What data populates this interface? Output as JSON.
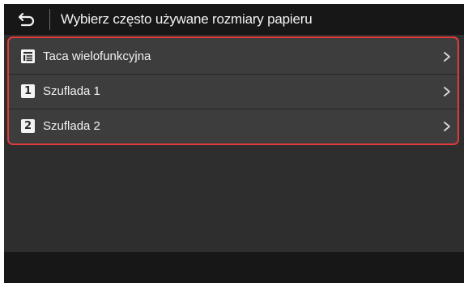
{
  "header": {
    "title": "Wybierz często używane rozmiary papieru",
    "back_icon": "back-arrow-icon"
  },
  "list": {
    "items": [
      {
        "label": "Taca wielofunkcyjna",
        "icon": "multipurpose-tray-icon",
        "icon_text": ""
      },
      {
        "label": "Szuflada 1",
        "icon": "drawer-1-icon",
        "icon_text": "1"
      },
      {
        "label": "Szuflada 2",
        "icon": "drawer-2-icon",
        "icon_text": "2"
      }
    ],
    "chevron_icon": "chevron-right-icon"
  },
  "colors": {
    "highlight_border": "#e23a3a",
    "background": "#2e2e2e",
    "bar": "#171717",
    "list_item": "#3d3d3d",
    "text": "#f2f2f2"
  }
}
